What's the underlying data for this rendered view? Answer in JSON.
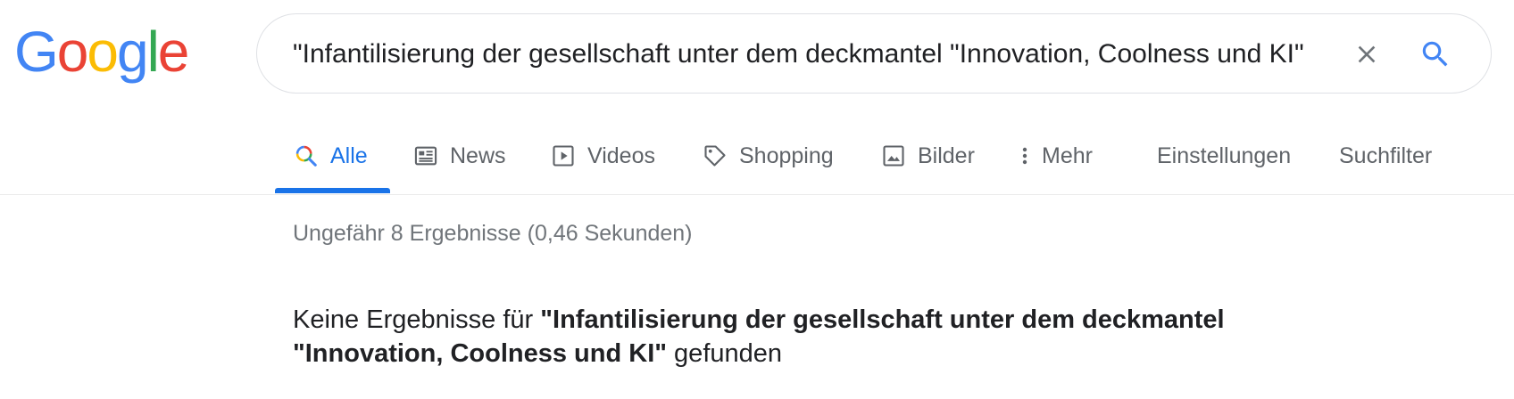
{
  "logo": {
    "letters": [
      "G",
      "o",
      "o",
      "g",
      "l",
      "e"
    ],
    "colors": [
      "#4285F4",
      "#EA4335",
      "#FBBC05",
      "#4285F4",
      "#34A853",
      "#EA4335"
    ]
  },
  "search": {
    "value": "\"Infantilisierung der gesellschaft unter dem deckmantel \"Innovation, Coolness und KI\"",
    "clear_icon": "close-icon",
    "search_icon": "search-icon"
  },
  "tabs": [
    {
      "label": "Alle",
      "icon": "search-multicolor-icon",
      "active": true
    },
    {
      "label": "News",
      "icon": "news-icon"
    },
    {
      "label": "Videos",
      "icon": "video-play-icon"
    },
    {
      "label": "Shopping",
      "icon": "tag-icon"
    },
    {
      "label": "Bilder",
      "icon": "image-icon"
    },
    {
      "label": "Mehr",
      "icon": "more-vertical-icon"
    },
    {
      "label": "Einstellungen"
    },
    {
      "label": "Suchfilter"
    }
  ],
  "stats": "Ungefähr 8 Ergebnisse (0,46 Sekunden)",
  "no_results": {
    "prefix": "Keine Ergebnisse für ",
    "query_line1": "\"Infantilisierung der gesellschaft unter dem deckmantel",
    "query_line2": "\"Innovation, Coolness und KI\"",
    "suffix": " gefunden"
  },
  "colors": {
    "accent": "#1a73e8",
    "tab_text": "#5f6368",
    "stats_text": "#70757a",
    "border": "#dfe1e5"
  }
}
